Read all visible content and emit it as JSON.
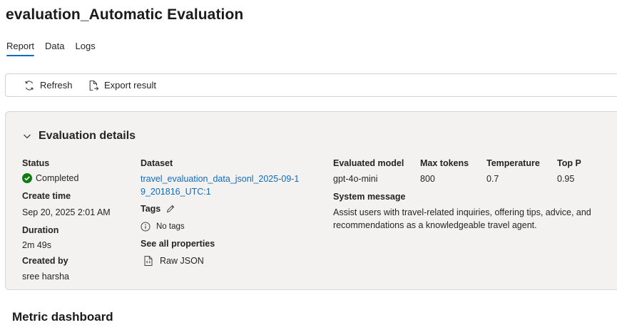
{
  "page": {
    "title": "evaluation_Automatic Evaluation"
  },
  "tabs": [
    {
      "label": "Report",
      "active": true
    },
    {
      "label": "Data",
      "active": false
    },
    {
      "label": "Logs",
      "active": false
    }
  ],
  "toolbar": {
    "refresh": {
      "label": "Refresh",
      "icon": "refresh-icon"
    },
    "export": {
      "label": "Export result",
      "icon": "export-icon"
    }
  },
  "details": {
    "header": "Evaluation details",
    "status": {
      "label": "Status",
      "value": "Completed",
      "color": "#107c10"
    },
    "create_time": {
      "label": "Create time",
      "value": "Sep 20, 2025 2:01 AM"
    },
    "duration": {
      "label": "Duration",
      "value": "2m 49s"
    },
    "created_by": {
      "label": "Created by",
      "value": "sree harsha"
    },
    "dataset": {
      "label": "Dataset",
      "value": "travel_evaluation_data_jsonl_2025-09-19_201816_UTC:1"
    },
    "tags": {
      "label": "Tags",
      "empty_text": "No tags"
    },
    "see_all": {
      "label": "See all properties"
    },
    "raw_json": {
      "label": "Raw JSON"
    },
    "evaluated_model": {
      "label": "Evaluated model",
      "value": "gpt-4o-mini"
    },
    "max_tokens": {
      "label": "Max tokens",
      "value": "800"
    },
    "temperature": {
      "label": "Temperature",
      "value": "0.7"
    },
    "top_p": {
      "label": "Top P",
      "value": "0.95"
    },
    "system_message": {
      "label": "System message",
      "value": "Assist users with travel-related inquiries, offering tips, advice, and recommendations as a knowledgeable travel agent."
    }
  },
  "metric_dashboard": {
    "title": "Metric dashboard"
  },
  "colors": {
    "accent": "#0f6cbd",
    "card_bg": "#f3f2f1",
    "success": "#107c10"
  }
}
